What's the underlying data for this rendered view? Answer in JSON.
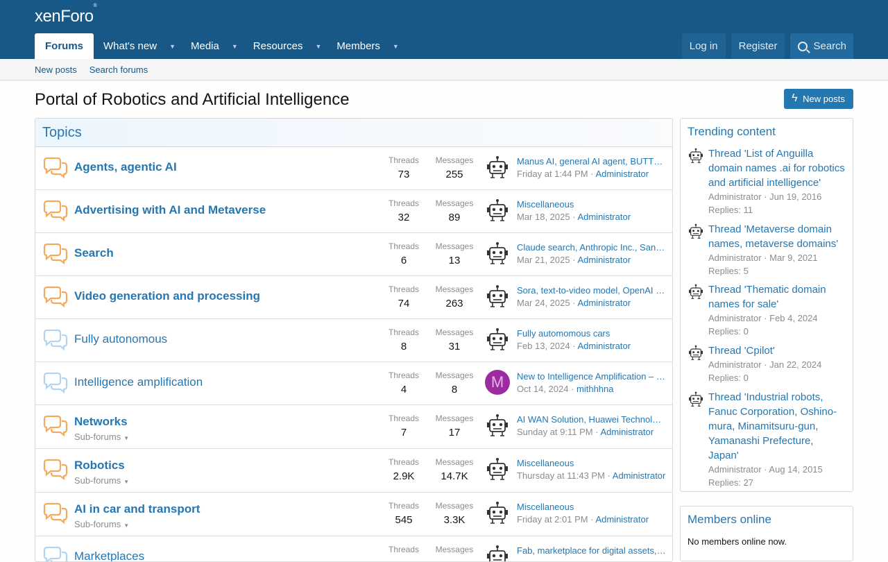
{
  "site": {
    "logo": "xenForo",
    "logo_mark": "®"
  },
  "nav": {
    "tabs": [
      {
        "label": "Forums"
      },
      {
        "label": "What's new"
      },
      {
        "label": "Media"
      },
      {
        "label": "Resources"
      },
      {
        "label": "Members"
      }
    ],
    "login": "Log in",
    "register": "Register",
    "search": "Search"
  },
  "subnav": {
    "new_posts": "New posts",
    "search_forums": "Search forums"
  },
  "page": {
    "title": "Portal of Robotics and Artificial Intelligence",
    "new_posts_btn": "New posts"
  },
  "forum": {
    "header": "Topics",
    "threads_label": "Threads",
    "messages_label": "Messages",
    "subforums_label": "Sub-forums",
    "nodes": [
      {
        "title": "Agents, agentic AI",
        "threads": "73",
        "messages": "255",
        "last_title": "Manus AI, general AI agent, BUTTERFLY EFFECT",
        "last_date": "Friday at 1:44 PM",
        "last_user": "Administrator"
      },
      {
        "title": "Advertising with AI and Metaverse",
        "threads": "32",
        "messages": "89",
        "last_title": "Miscellaneous",
        "last_date": "Mar 18, 2025",
        "last_user": "Administrator"
      },
      {
        "title": "Search",
        "threads": "6",
        "messages": "13",
        "last_title": "Claude search, Anthropic Inc., San Francisco",
        "last_date": "Mar 21, 2025",
        "last_user": "Administrator"
      },
      {
        "title": "Video generation and processing",
        "threads": "74",
        "messages": "263",
        "last_title": "Sora, text-to-video model, OpenAI Inc.",
        "last_date": "Mar 24, 2025",
        "last_user": "Administrator"
      },
      {
        "title": "Fully autonomous",
        "threads": "8",
        "messages": "31",
        "last_title": "Fully automomous cars",
        "last_date": "Feb 13, 2024",
        "last_user": "Administrator"
      },
      {
        "title": "Intelligence amplification",
        "threads": "4",
        "messages": "8",
        "last_title": "New to Intelligence Amplification – Introduction",
        "last_date": "Oct 14, 2024",
        "last_user": "mithhhna",
        "avatar_letter": "M"
      },
      {
        "title": "Networks",
        "threads": "7",
        "messages": "17",
        "last_title": "AI WAN Solution, Huawei Technologies",
        "last_date": "Sunday at 9:11 PM",
        "last_user": "Administrator"
      },
      {
        "title": "Robotics",
        "threads": "2.9K",
        "messages": "14.7K",
        "last_title": "Miscellaneous",
        "last_date": "Thursday at 11:43 PM",
        "last_user": "Administrator"
      },
      {
        "title": "AI in car and transport",
        "threads": "545",
        "messages": "3.3K",
        "last_title": "Miscellaneous",
        "last_date": "Friday at 2:01 PM",
        "last_user": "Administrator"
      },
      {
        "title": "Marketplaces",
        "threads": "",
        "messages": "",
        "last_title": "Fab, marketplace for digital assets, Epic Games",
        "last_date": "",
        "last_user": ""
      }
    ]
  },
  "trending": {
    "title": "Trending content",
    "items": [
      {
        "title": "Thread 'List of Anguilla domain names .ai for robotics and artificial intelligence'",
        "meta": "Administrator · Jun 19, 2016",
        "replies": "Replies: 11"
      },
      {
        "title": "Thread 'Metaverse domain names, metaverse domains'",
        "meta": "Administrator · Mar 9, 2021",
        "replies": "Replies: 5"
      },
      {
        "title": "Thread 'Thematic domain names for sale'",
        "meta": "Administrator · Feb 4, 2024",
        "replies": "Replies: 0"
      },
      {
        "title": "Thread 'Cpilot'",
        "meta": "Administrator · Jan 22, 2024",
        "replies": "Replies: 0"
      },
      {
        "title": "Thread 'Industrial robots, Fanuc Corporation, Oshino-mura, Minamitsuru-gun, Yamanashi Prefecture, Japan'",
        "meta": "Administrator · Aug 14, 2015",
        "replies": "Replies: 27"
      }
    ]
  },
  "members_online": {
    "title": "Members online",
    "text": "No members online now."
  },
  "colors": {
    "header": "#185886",
    "link": "#2577b1",
    "unread_icon": "#f5a95b",
    "read_icon": "#b3d4f0",
    "avatar_m": "#9b2ba0"
  }
}
